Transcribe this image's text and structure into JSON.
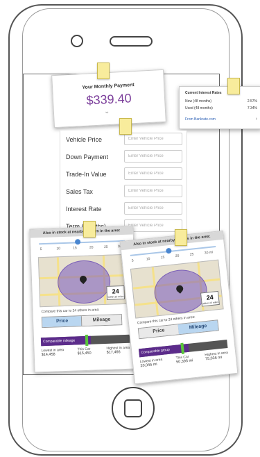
{
  "payment": {
    "label": "Your Monthly Payment",
    "amount": "$339.40"
  },
  "rates": {
    "title": "Current Interest Rates",
    "rows": [
      {
        "label": "New (48 months)",
        "value": "2.57%"
      },
      {
        "label": "Used (48 months)",
        "value": "7.34%"
      }
    ],
    "link": "From Bankrate.com"
  },
  "form": {
    "placeholder": "Enter Vehicle Price",
    "fields": [
      {
        "label": "Vehicle Price"
      },
      {
        "label": "Down Payment"
      },
      {
        "label": "Trade-In Value"
      },
      {
        "label": "Sales Tax"
      },
      {
        "label": "Interest Rate"
      },
      {
        "label": "Term (months)"
      }
    ]
  },
  "availability_left": {
    "header": "Also in stock at nearby dealers in the area:",
    "ticks": [
      "5",
      "10",
      "15",
      "20",
      "25",
      "30"
    ],
    "slider_value_fraction": 0.45,
    "count": "24",
    "count_label": "within 20 miles",
    "compare_text": "Compare this car to 24 others in area:",
    "tab_price": "Price",
    "tab_mileage": "Mileage",
    "bar_label": "Comparable mileage",
    "stats": [
      {
        "label": "Lowest in area",
        "value": "$14,458"
      },
      {
        "label": "This Car",
        "value": "$15,450"
      },
      {
        "label": "Highest in area",
        "value": "$17,466"
      }
    ]
  },
  "availability_right": {
    "header": "Also in stock at nearby dealers in the area:",
    "ticks": [
      "5",
      "10",
      "15",
      "20",
      "25",
      "30 mi"
    ],
    "slider_value_fraction": 0.45,
    "count": "24",
    "count_label": "within 20 miles",
    "compare_text": "Compare this car to 24 others in area:",
    "tab_price": "Price",
    "tab_mileage": "Mileage",
    "bar_label": "Comparable group",
    "stats": [
      {
        "label": "Lowest in area",
        "value": "20,045 mi"
      },
      {
        "label": "This Car",
        "value": "50,395 mi"
      },
      {
        "label": "Highest in area",
        "value": "75,036 mi"
      }
    ]
  }
}
